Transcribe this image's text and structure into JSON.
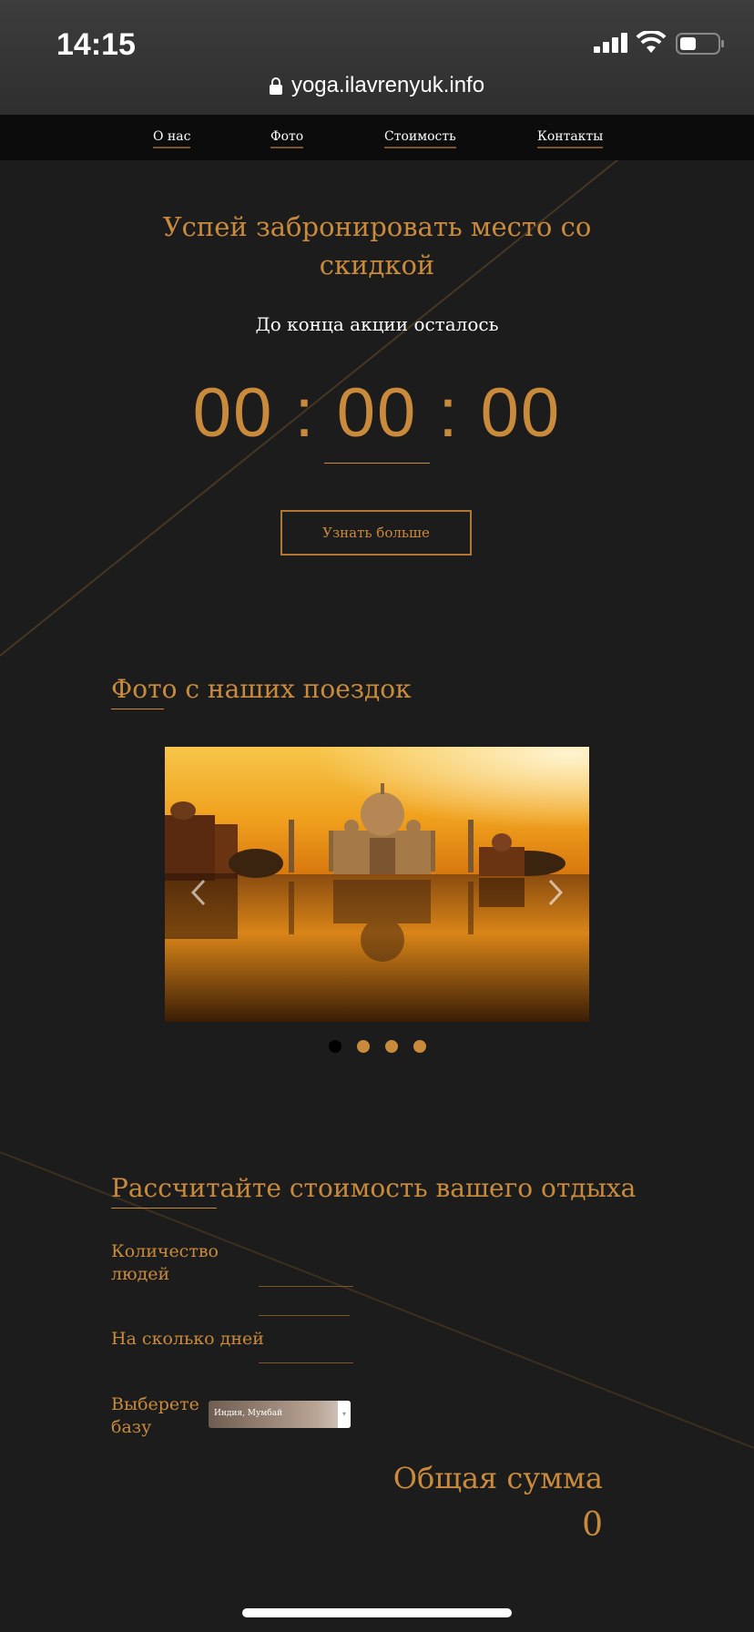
{
  "status_bar": {
    "time": "14:15",
    "url": "yoga.ilavrenyuk.info"
  },
  "nav": {
    "items": [
      "О нас",
      "Фото",
      "Стоимость",
      "Контакты"
    ]
  },
  "promo": {
    "title_line1": "Успей забронировать место со",
    "title_line2": "скидкой",
    "subtitle": "До конца акции осталось",
    "timer": {
      "hours": "00",
      "minutes": "00",
      "seconds": "00",
      "separator": ":"
    },
    "button_label": "Узнать больше"
  },
  "gallery": {
    "title": "Фото с наших поездок",
    "slide_count": 4,
    "active_slide": 1,
    "prev_icon": "chevron-left-icon",
    "next_icon": "chevron-right-icon"
  },
  "calculator": {
    "title": "Рассчитайте стоимость вашего отдыха",
    "people_label_line1": "Количество",
    "people_label_line2": "людей",
    "days_label": "На сколько дней",
    "base_label_line1": "Выберете",
    "base_label_line2": "базу",
    "base_selected": "Индия, Мумбай",
    "total_label": "Общая сумма",
    "total_value": "0"
  },
  "colors": {
    "accent": "#c98a3c",
    "background": "#1c1c1c",
    "nav_background": "#0c0c0c"
  }
}
